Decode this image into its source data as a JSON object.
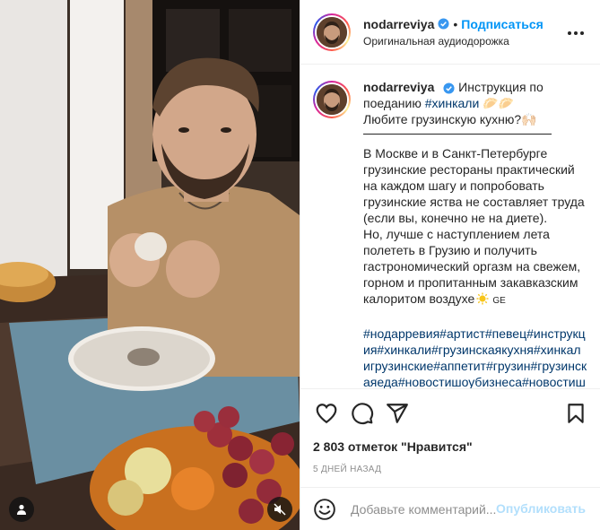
{
  "post": {
    "author": {
      "username": "nodarreviya",
      "verified": true,
      "follow_label": "Подписаться",
      "separator": "•",
      "audio_label": "Оригинальная аудиодорожка"
    },
    "caption": {
      "username": "nodarreviya",
      "line1_text": "Инструкция по поеданию ",
      "line1_hashtag": "#хинкали",
      "line1_suffix": " 🥟🥟",
      "line2": "Любите грузинскую кухню?🙌🏻",
      "para1": "В Москве и в Санкт-Петербурге грузинские рестораны практический на каждом шагу и попробовать грузинские яства не составляет труда (если вы, конечно не на диете).",
      "para2": "Но, лучше с наступлением лета полететь в Грузию и получить гастрономический оргазм на свежем, горном и пропитанным закавказским калоритом воздухе",
      "flag_text": "GE",
      "hashtags": [
        "#нодарревия",
        "#артист",
        "#певец",
        "#инструкция",
        "#хинкали",
        "#грузинскаякухня",
        "#хинкалигрузинские",
        "#аппетит",
        "#грузин",
        "#грузинскаяеда",
        "#новостишоубизнеса",
        "#новостишо"
      ]
    },
    "likes_text": "2 803 отметок \"Нравится\"",
    "date_text": "5 дней назад",
    "comment_box": {
      "placeholder": "Добавьте комментарий...",
      "publish_label": "Опубликовать"
    },
    "icons": {
      "like": "heart-icon",
      "comment": "comment-bubble-icon",
      "share": "paper-plane-icon",
      "save": "bookmark-icon",
      "more": "more-dots-icon",
      "emoji": "smiley-icon",
      "user_tag": "user-icon",
      "mute": "speaker-muted-icon"
    },
    "colors": {
      "accent_blue": "#0095f6",
      "hashtag_blue": "#00376b",
      "publish_disabled": "#b2dffc",
      "text": "#262626",
      "muted": "#8e8e8e",
      "border": "#efefef"
    }
  }
}
